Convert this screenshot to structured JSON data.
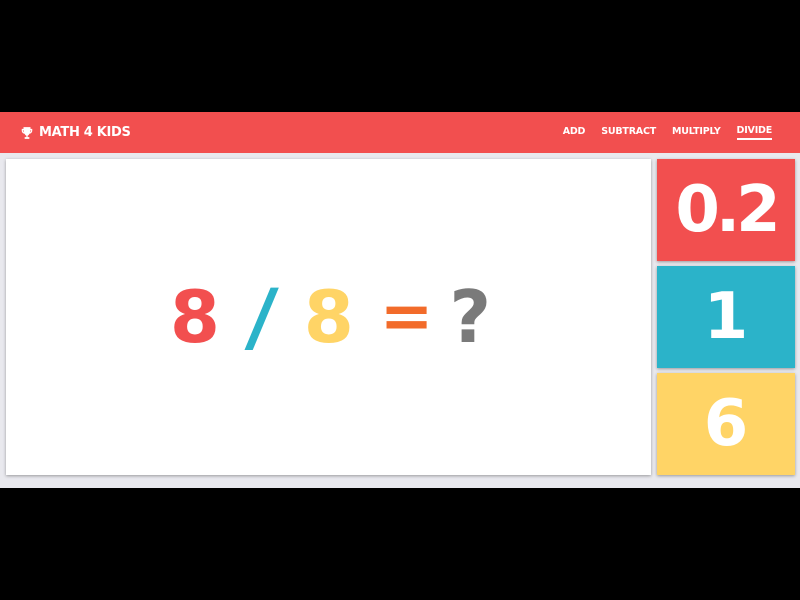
{
  "brand": {
    "icon": "trophy-icon",
    "title": "MATH 4 KIDS"
  },
  "nav": {
    "items": [
      {
        "label": "ADD",
        "active": false
      },
      {
        "label": "SUBTRACT",
        "active": false
      },
      {
        "label": "MULTIPLY",
        "active": false
      },
      {
        "label": "DIVIDE",
        "active": true
      }
    ]
  },
  "equation": {
    "operand_a": "8",
    "operator": "/",
    "operand_b": "8",
    "equals": "=",
    "unknown": "?"
  },
  "answers": [
    {
      "value": "0.2",
      "color": "#f24f4f"
    },
    {
      "value": "1",
      "color": "#2bb3c9"
    },
    {
      "value": "6",
      "color": "#ffd466"
    }
  ],
  "colors": {
    "navbar": "#f24f4f",
    "operand_a": "#f24f4f",
    "operator": "#2bb3c9",
    "operand_b": "#ffd466",
    "equals": "#f26b2a",
    "unknown": "#7a7a7a"
  }
}
